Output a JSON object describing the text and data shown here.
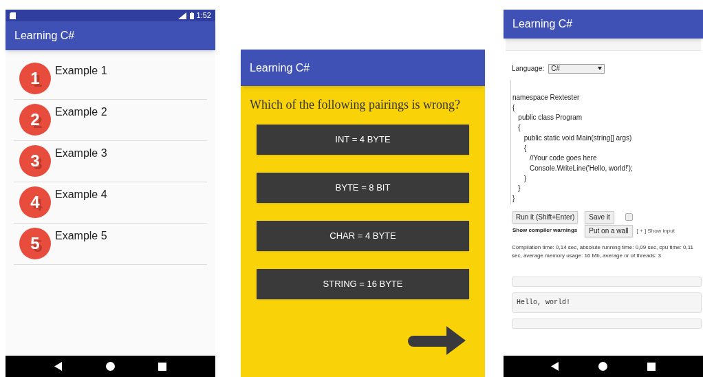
{
  "list_screen": {
    "status_bar": {
      "time": "1:52"
    },
    "app_bar": {
      "title": "Learning C#"
    },
    "items": [
      {
        "number": "1",
        "label": "Example 1"
      },
      {
        "number": "2",
        "label": "Example 2"
      },
      {
        "number": "3",
        "label": "Example 3"
      },
      {
        "number": "4",
        "label": "Example 4"
      },
      {
        "number": "5",
        "label": "Example 5"
      }
    ]
  },
  "quiz_screen": {
    "app_bar": {
      "title": "Learning C#"
    },
    "question": "Which of the following pairings is wrong?",
    "answers": [
      "INT = 4 BYTE",
      "BYTE = 8 BIT",
      "CHAR = 4 BYTE",
      "STRING = 16 BYTE"
    ]
  },
  "code_screen": {
    "app_bar": {
      "title": "Learning C#"
    },
    "language_label": "Language:",
    "language": "C#",
    "code": [
      "namespace Rextester",
      "{",
      "   public class Program",
      "   {",
      "      public static void Main(string[] args)",
      "      {",
      "         //Your code goes here",
      "         Console.WriteLine('Hello, world!');",
      "      }",
      "   }",
      "}"
    ],
    "run_button": "Run it (Shift+Enter)",
    "save_button": "Save it",
    "warnings_checkbox": {
      "label": "Show compiler warnings",
      "checked": false
    },
    "wall_button": "Put on a wall",
    "show_input_link": "[ + ] Show input",
    "stats": "Compilation time: 0,14 sec, absolute running time: 0,09 sec, cpu time: 0,11 sec, average memory usage: 16 Mb, average nr of threads: 3",
    "output": "Hello, world!"
  }
}
